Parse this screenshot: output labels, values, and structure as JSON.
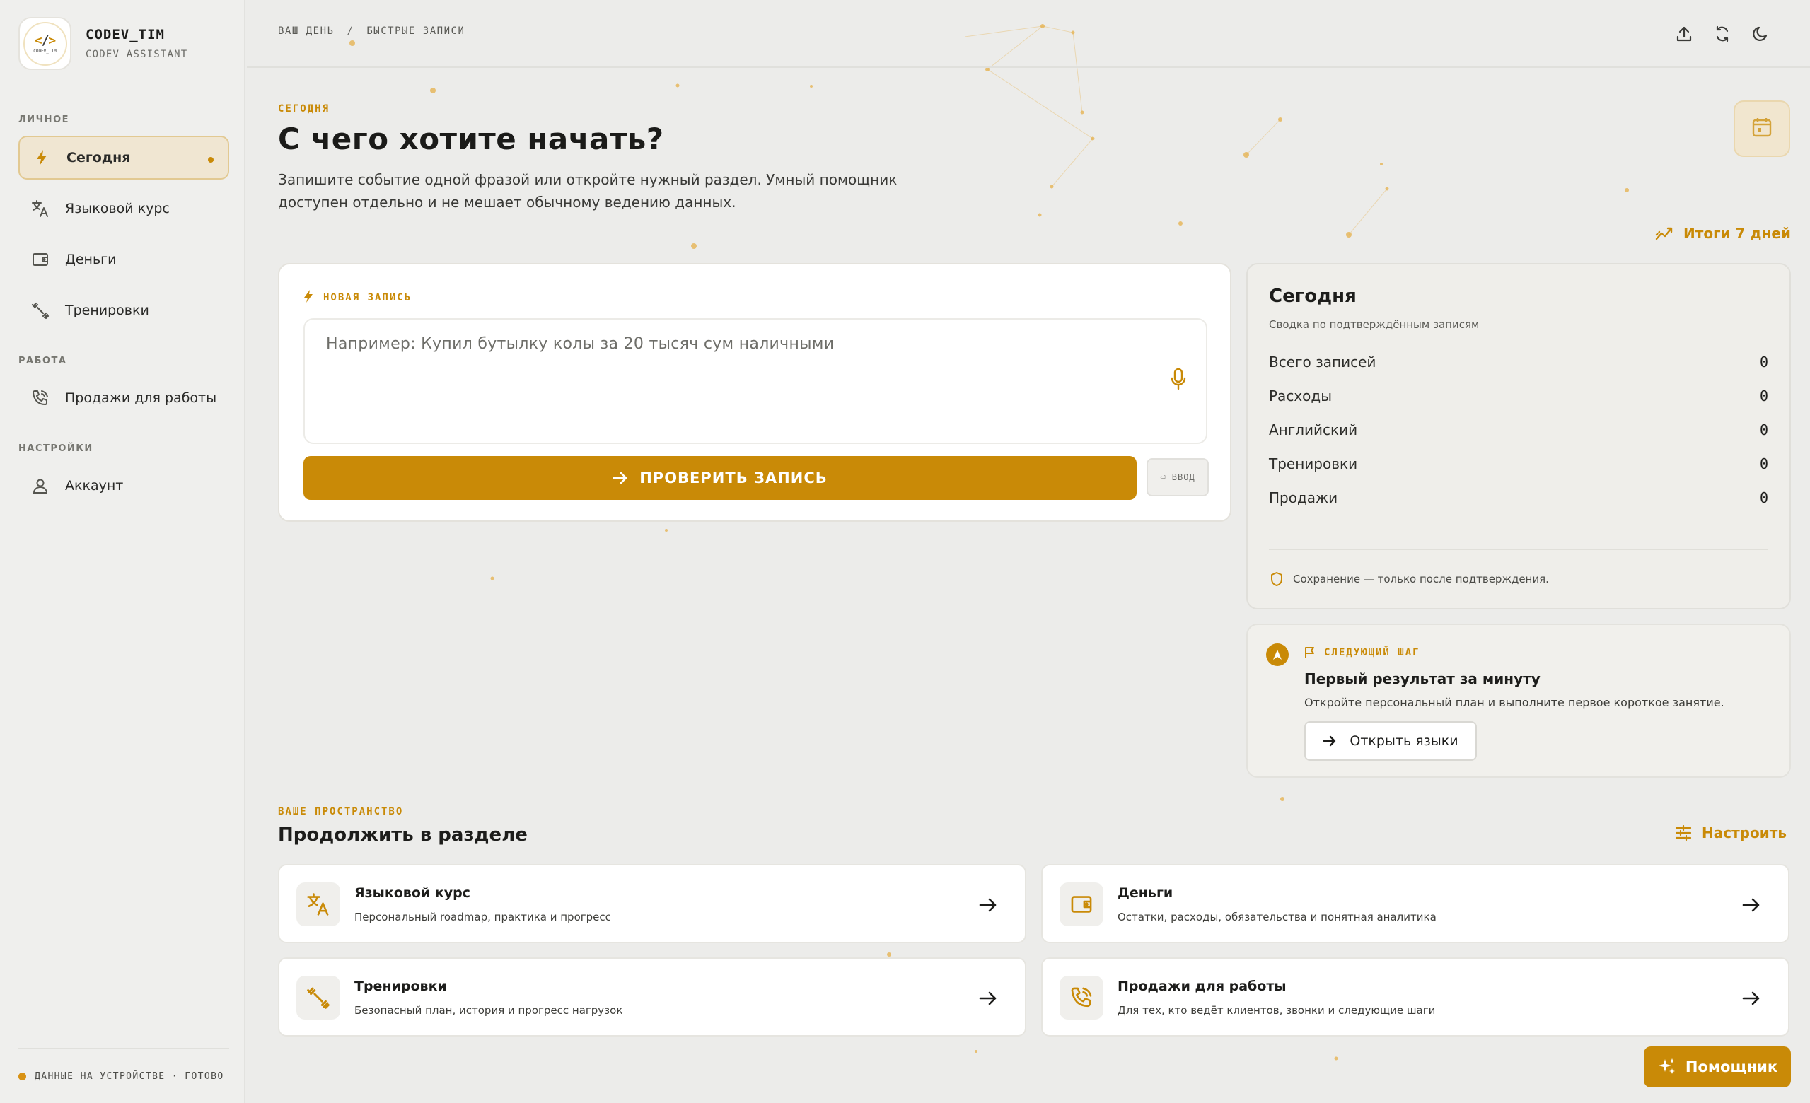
{
  "brand": {
    "name": "CODEV_TIM",
    "subtitle": "CODEV ASSISTANT",
    "logo_text": "CODEV_TIM"
  },
  "sidebar": {
    "sections": [
      {
        "label": "ЛИЧНОЕ"
      },
      {
        "label": "РАБОТА"
      },
      {
        "label": "НАСТРОЙКИ"
      }
    ],
    "items": [
      {
        "label": "Сегодня",
        "icon": "bolt-icon",
        "active": true
      },
      {
        "label": "Языковой курс",
        "icon": "translate-icon"
      },
      {
        "label": "Деньги",
        "icon": "wallet-icon"
      },
      {
        "label": "Тренировки",
        "icon": "dumbbell-icon"
      },
      {
        "label": "Продажи для работы",
        "icon": "phone-icon"
      },
      {
        "label": "Аккаунт",
        "icon": "user-icon"
      }
    ],
    "footer": "ДАННЫЕ НА УСТРОЙСТВЕ · ГОТОВО"
  },
  "topbar": {
    "breadcrumb": [
      "ВАШ ДЕНЬ",
      "БЫСТРЫЕ ЗАПИСИ"
    ],
    "separator": "/",
    "icons": [
      "upload-icon",
      "sync-icon",
      "moon-icon"
    ]
  },
  "header": {
    "eyebrow": "СЕГОДНЯ",
    "title": "С чего хотите начать?",
    "description": "Запишите событие одной фразой или откройте нужный раздел. Умный помощник доступен отдельно и не мешает обычному ведению данных.",
    "weekly_link": "Итоги 7 дней"
  },
  "entry": {
    "label": "НОВАЯ ЗАПИСЬ",
    "placeholder": "Например: Купил бутылку колы за 20 тысяч сум наличными",
    "submit_label": "ПРОВЕРИТЬ ЗАПИСЬ",
    "kbd_hint": "⏎ ВВОД"
  },
  "summary": {
    "title": "Сегодня",
    "subtitle": "Сводка по подтверждённым записям",
    "stats": [
      {
        "label": "Всего записей",
        "value": "0"
      },
      {
        "label": "Расходы",
        "value": "0"
      },
      {
        "label": "Английский",
        "value": "0"
      },
      {
        "label": "Тренировки",
        "value": "0"
      },
      {
        "label": "Продажи",
        "value": "0"
      }
    ],
    "note": "Сохранение — только после подтверждения."
  },
  "next_step": {
    "label": "СЛЕДУЮЩИЙ ШАГ",
    "title": "Первый результат за минуту",
    "description": "Откройте персональный план и выполните первое короткое занятие.",
    "button_label": "Открыть языки"
  },
  "workspace": {
    "eyebrow": "ВАШЕ ПРОСТРАНСТВО",
    "title": "Продолжить в разделе",
    "configure_label": "Настроить",
    "tiles": [
      {
        "title": "Языковой курс",
        "description": "Персональный roadmap, практика и прогресс",
        "icon": "translate-icon"
      },
      {
        "title": "Деньги",
        "description": "Остатки, расходы, обязательства и понятная аналитика",
        "icon": "wallet-icon"
      },
      {
        "title": "Тренировки",
        "description": "Безопасный план, история и прогресс нагрузок",
        "icon": "dumbbell-icon"
      },
      {
        "title": "Продажи для работы",
        "description": "Для тех, кто ведёт клиентов, звонки и следующие шаги",
        "icon": "phone-icon"
      }
    ]
  },
  "assistant": {
    "label": "Помощник"
  },
  "colors": {
    "accent": "#c98a07",
    "background": "#ececea",
    "card": "#ffffff"
  }
}
